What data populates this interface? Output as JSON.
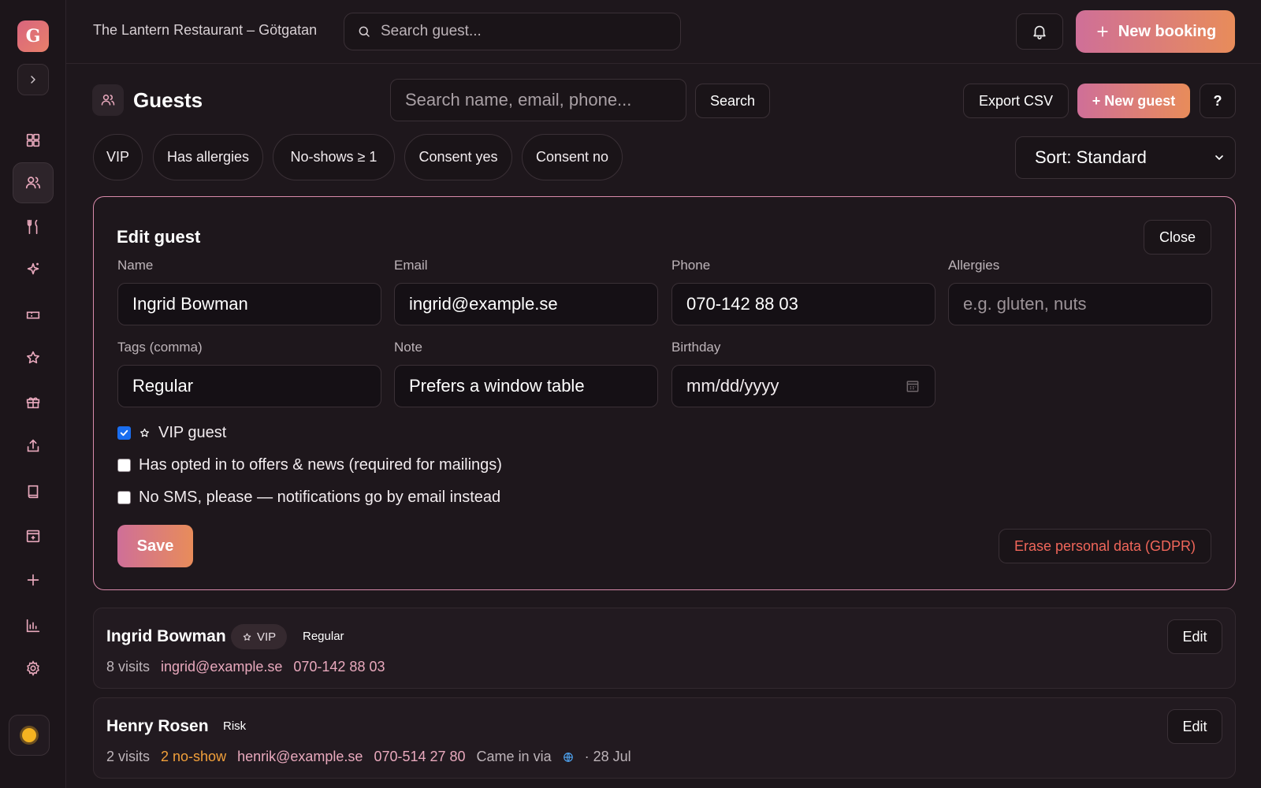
{
  "app": {
    "logo_letter": "G",
    "restaurant_name": "The Lantern Restaurant – Götgatan"
  },
  "sidebar": {
    "items": [
      {
        "icon": "grid-icon",
        "label": "Dashboard"
      },
      {
        "icon": "users-icon",
        "label": "Guests",
        "active": true
      },
      {
        "icon": "cutlery-icon",
        "label": "Tables"
      },
      {
        "icon": "sparkle-icon",
        "label": "Highlights"
      },
      {
        "icon": "ticket-icon",
        "label": "Vouchers"
      },
      {
        "icon": "star-icon",
        "label": "Reviews"
      },
      {
        "icon": "gift-icon",
        "label": "Gift cards"
      },
      {
        "icon": "upload-icon",
        "label": "Export"
      },
      {
        "icon": "book-icon",
        "label": "Menu"
      },
      {
        "icon": "calendar-plus-icon",
        "label": "Schedule"
      },
      {
        "icon": "plus-icon",
        "label": "Add"
      },
      {
        "icon": "bar-chart-icon",
        "label": "Reports"
      },
      {
        "icon": "gear-icon",
        "label": "Settings"
      }
    ]
  },
  "topbar": {
    "search_placeholder": "Search guest...",
    "new_booking_label": "New booking"
  },
  "guests_page": {
    "title": "Guests",
    "search_placeholder": "Search name, email, phone...",
    "search_button": "Search",
    "export_button": "Export CSV",
    "new_guest_button": "+ New guest",
    "help_button": "?",
    "filters": [
      "VIP",
      "Has allergies",
      "No-shows ≥ 1",
      "Consent yes",
      "Consent no"
    ],
    "sort_label": "Sort: Standard"
  },
  "edit_guest": {
    "title": "Edit guest",
    "close_button": "Close",
    "labels": {
      "name": "Name",
      "email": "Email",
      "phone": "Phone",
      "allergies": "Allergies",
      "tags": "Tags (comma)",
      "note": "Note",
      "birthday": "Birthday"
    },
    "values": {
      "name": "Ingrid Bowman",
      "email": "ingrid@example.se",
      "phone": "070-142 88 03",
      "allergies": "",
      "tags": "Regular",
      "note": "Prefers a window table",
      "birthday": ""
    },
    "placeholders": {
      "allergies": "e.g. gluten, nuts",
      "birthday": "mm/dd/yyyy"
    },
    "checkboxes": {
      "vip_label": "VIP guest",
      "vip_checked": true,
      "offers_label": "Has opted in to offers & news (required for mailings)",
      "offers_checked": false,
      "no_sms_label": "No SMS, please — notifications go by email instead",
      "no_sms_checked": false
    },
    "save_button": "Save",
    "gdpr_button": "Erase personal data (GDPR)"
  },
  "guest_list": [
    {
      "name": "Ingrid Bowman",
      "vip_label": "VIP",
      "tag": "Regular",
      "visits": "8 visits",
      "email": "ingrid@example.se",
      "phone": "070-142 88 03",
      "edit_label": "Edit"
    },
    {
      "name": "Henry Rosen",
      "tag": "Risk",
      "visits": "2 visits",
      "no_show": "2 no-show",
      "email": "henrik@example.se",
      "phone": "070-514 27 80",
      "source_text": "Came in via",
      "date_text": "· 28 Jul",
      "edit_label": "Edit"
    }
  ],
  "colors": {
    "accent_start": "#cf6f98",
    "accent_end": "#e88c5a",
    "pink_text": "#e9a9bd",
    "danger": "#f0665a",
    "warning": "#f2a03a",
    "background": "#1e171c"
  }
}
